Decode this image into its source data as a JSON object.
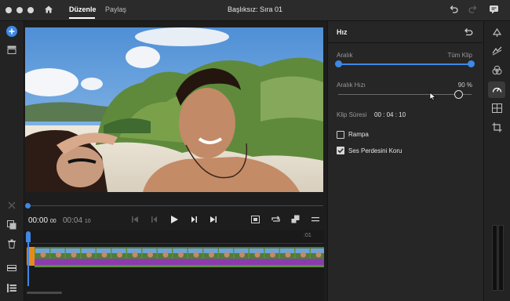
{
  "titlebar": {
    "tabs": [
      "Düzenle",
      "Paylaş"
    ],
    "title": "Başlıksız: Sıra 01"
  },
  "icons": {
    "home": "home-icon",
    "undo": "undo-icon",
    "redo": "redo-icon",
    "feedback": "chat-icon",
    "add": "plus-icon",
    "media": "media-bin-icon",
    "cut": "scissors-icon",
    "duplicate": "duplicate-icon",
    "delete": "trash-icon",
    "fit": "fit-icon",
    "tracks": "track-list-icon"
  },
  "transport": {
    "current_main": "00:00",
    "current_frames": "00",
    "duration_main": "00:04",
    "duration_frames": "10",
    "ruler_mark": ":01"
  },
  "speed_panel": {
    "title": "Hız",
    "range_label": "Aralık",
    "range_value": "Tüm Klip",
    "rate_label": "Aralık Hızı",
    "rate_value": "90 %",
    "rate_fraction": 0.9,
    "duration_label": "Klip Süresi",
    "duration_value": "00 : 04 : 10",
    "ramp_label": "Rampa",
    "ramp_checked": false,
    "pitch_label": "Ses Perdesini Koru",
    "pitch_checked": true
  },
  "colors": {
    "accent": "#3e88e6",
    "clip_video": "#5b8e3a",
    "clip_audio": "#8c3ab0",
    "clip_handle": "#e88a1a"
  }
}
